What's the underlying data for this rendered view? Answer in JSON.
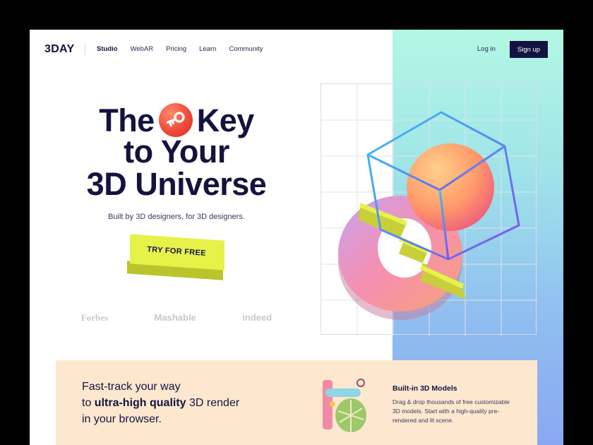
{
  "brand": {
    "logo": "3DAY"
  },
  "nav": {
    "items": [
      {
        "label": "Studio",
        "active": true
      },
      {
        "label": "WebAR",
        "active": false
      },
      {
        "label": "Pricing",
        "active": false
      },
      {
        "label": "Learn",
        "active": false
      },
      {
        "label": "Community",
        "active": false
      }
    ],
    "login_label": "Log in",
    "signup_label": "Sign up"
  },
  "hero": {
    "title_line1_a": "The",
    "title_line1_b": "Key",
    "title_line2": "to Your",
    "title_line3": "3D Universe",
    "subtitle": "Built by 3D designers, for 3D designers.",
    "cta_label": "TRY FOR FREE"
  },
  "press": [
    "Forbes",
    "Mashable",
    "indeed"
  ],
  "band": {
    "line1": "Fast-track your way",
    "line2_prefix": "to ",
    "line2_bold": "ultra-high quality",
    "line2_suffix": " 3D render",
    "line3": "in your browser.",
    "feature_title": "Built-in 3D Models",
    "feature_desc": "Drag & drop thousands of free customizable 3D models. Start with a high-quality pre-rendered and lit scene."
  },
  "icons": {
    "key": "key-icon"
  },
  "colors": {
    "navy": "#14133f",
    "accent_yellow": "#e6f24a",
    "key_red": "#f04a3a",
    "band_peach": "#fde8cf",
    "panel_top": "#b3f7e4",
    "panel_bottom": "#8aa8f2"
  }
}
